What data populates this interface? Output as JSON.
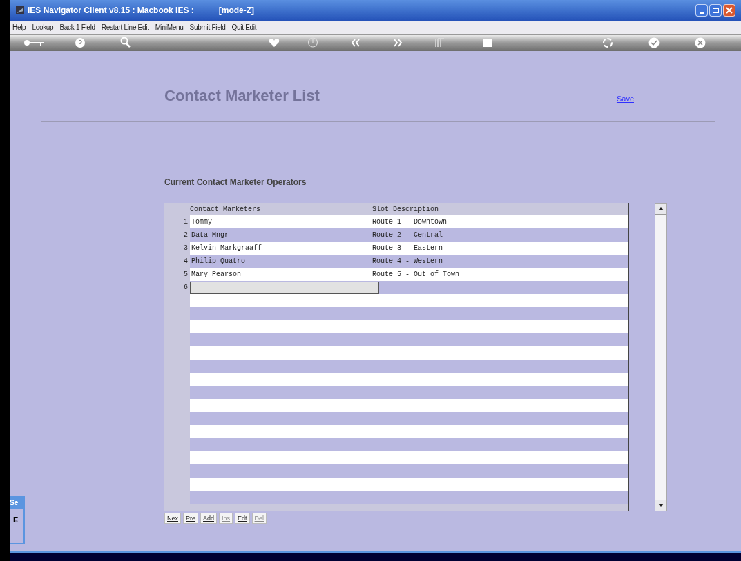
{
  "window": {
    "title": "IES Navigator Client v8.15 : Macbook IES :",
    "mode": "[mode-Z]"
  },
  "menu": [
    "Help",
    "Lookup",
    "Back 1 Field",
    "Restart Line Edit",
    "MiniMenu",
    "Submit Field",
    "Quit Edit"
  ],
  "page": {
    "title": "Contact Marketer List",
    "save_link": "Save",
    "section_title": "Current Contact Marketer Operators"
  },
  "table": {
    "columns": [
      "Contact Marketers",
      "Slot Description"
    ],
    "rows": [
      {
        "number": "1",
        "marketer": "Tommy",
        "slot": "Route 1 - Downtown"
      },
      {
        "number": "2",
        "marketer": "Data Mngr",
        "slot": "Route 2 - Central"
      },
      {
        "number": "3",
        "marketer": "Kelvin Markgraaff",
        "slot": "Route 3 - Eastern"
      },
      {
        "number": "4",
        "marketer": "Philip Quatro",
        "slot": "Route 4 - Western"
      },
      {
        "number": "5",
        "marketer": "Mary Pearson",
        "slot": "Route 5 - Out of Town"
      },
      {
        "number": "6",
        "kind": "input"
      }
    ]
  },
  "buttons": [
    {
      "label": "Nex",
      "disabled": false
    },
    {
      "label": "Pre",
      "disabled": false
    },
    {
      "label": "Add",
      "disabled": false
    },
    {
      "label": "Ins",
      "disabled": true
    },
    {
      "label": "Edt",
      "disabled": false
    },
    {
      "label": "Del",
      "disabled": true
    }
  ],
  "side_panel": {
    "title": "Se",
    "text": "E"
  }
}
